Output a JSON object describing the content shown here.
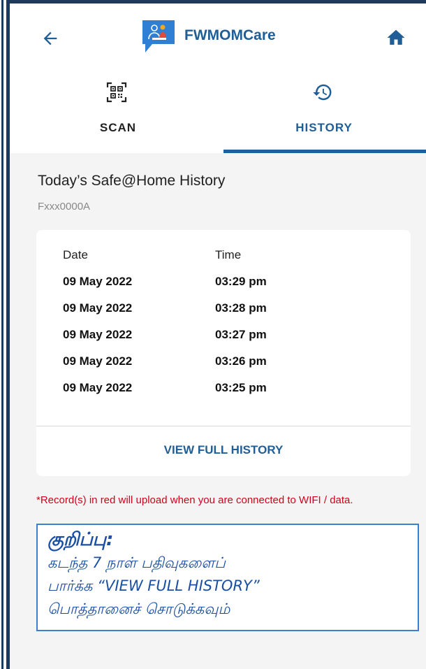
{
  "header": {
    "app_title": "FWMOMCare",
    "icons": {
      "back": "back-arrow-icon",
      "logo": "fwmomcare-logo-icon",
      "home": "home-icon"
    }
  },
  "tabs": [
    {
      "label": "SCAN",
      "icon": "qr-code-icon",
      "active": false
    },
    {
      "label": "HISTORY",
      "icon": "history-icon",
      "active": true
    }
  ],
  "history": {
    "title": "Today’s Safe@Home History",
    "subtitle": "Fxxx0000A",
    "columns": {
      "date": "Date",
      "time": "Time"
    },
    "rows": [
      {
        "date": "09 May 2022",
        "time": "03:29 pm"
      },
      {
        "date": "09 May 2022",
        "time": "03:28 pm"
      },
      {
        "date": "09 May 2022",
        "time": "03:27 pm"
      },
      {
        "date": "09 May 2022",
        "time": "03:26 pm"
      },
      {
        "date": "09 May 2022",
        "time": "03:25 pm"
      }
    ],
    "view_full_label": "VIEW FULL HISTORY"
  },
  "notice": "*Record(s) in red will upload when you are connected to WIFI / data.",
  "tamil_note": {
    "heading": "குறிப்பு:",
    "line1": "கடந்த 7 நாள் பதிவுகளைப்",
    "line2": "பார்க்க “VIEW FULL HISTORY”",
    "line3": "பொத்தானைச் சொடுக்கவும்"
  },
  "colors": {
    "accent": "#1f5e97",
    "alert": "#d0021b",
    "frame": "#1e3a5a",
    "callout_border": "#3a7fd1"
  }
}
